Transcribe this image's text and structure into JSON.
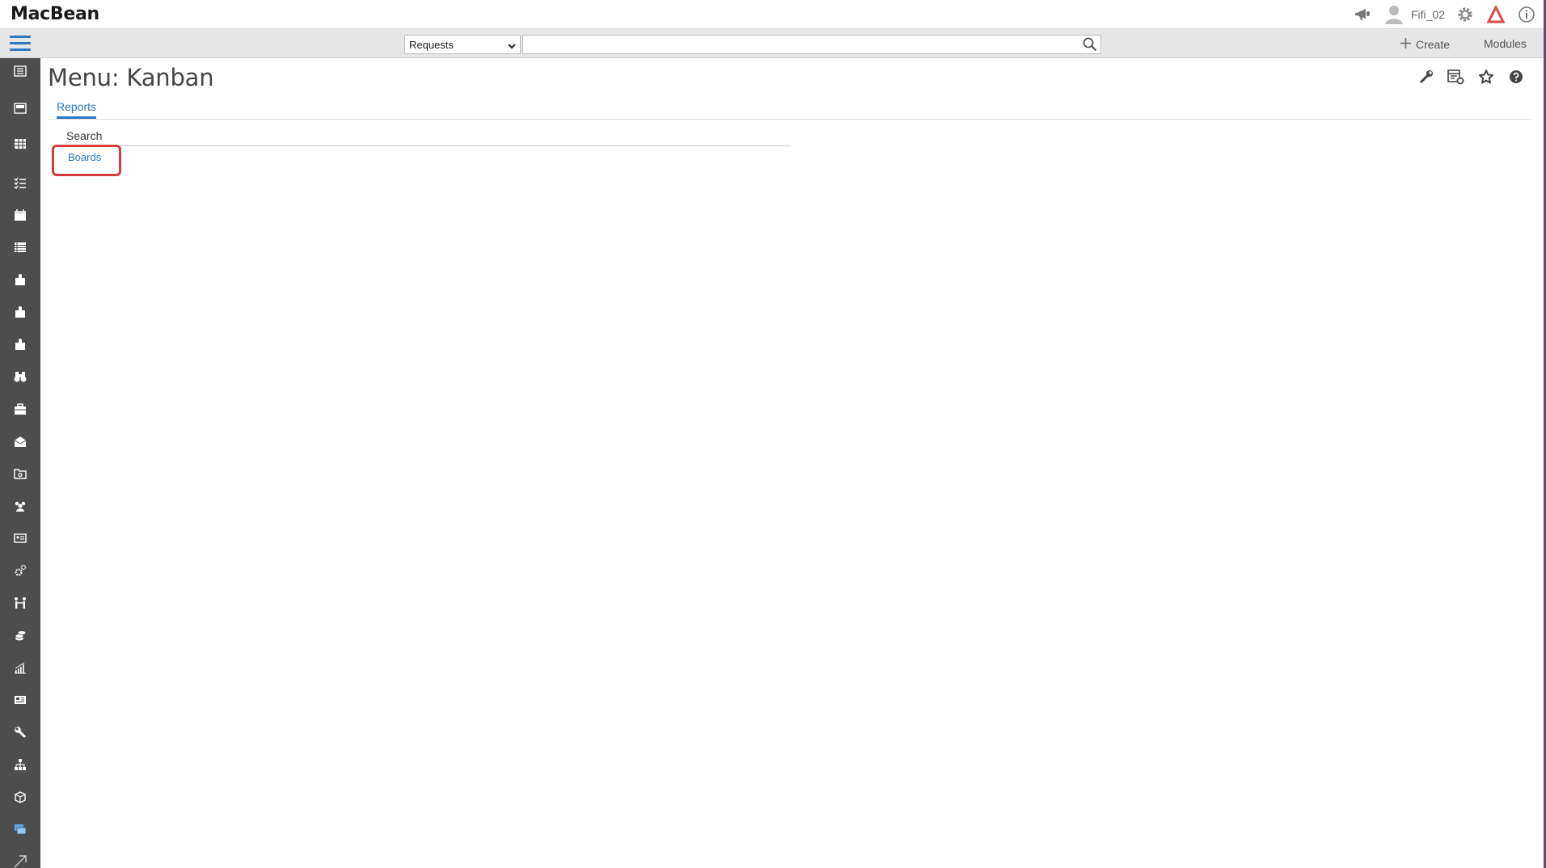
{
  "app": {
    "brand": "MacBean"
  },
  "header": {
    "username": "Fifi_02",
    "icons": [
      "megaphone-icon",
      "user-avatar-icon",
      "gear-icon",
      "brand-logo-icon",
      "info-icon"
    ]
  },
  "toolbar": {
    "search_scope": "Requests",
    "search_placeholder": "",
    "create_label": "Create",
    "modules_label": "Modules"
  },
  "sidebar": {
    "items": [
      "building-icon",
      "tray-icon",
      "table-icon",
      "tasks-icon",
      "calendar-icon",
      "list-icon",
      "puzzle-icon",
      "puzzle-icon",
      "puzzle-icon",
      "binoculars-icon",
      "briefcase-icon",
      "mail-open-icon",
      "folder-icon",
      "people-icon",
      "contact-card-icon",
      "gears-icon",
      "network-people-icon",
      "coins-icon",
      "chart-icon",
      "news-icon",
      "wrench-icon",
      "org-chart-icon",
      "package-icon",
      "windows-icon",
      "expand-icon"
    ]
  },
  "page": {
    "title": "Menu: Kanban",
    "tab": "Reports",
    "section_title": "Search",
    "section_link": "Boards"
  },
  "colors": {
    "accent": "#2a78c0",
    "sidebar": "#4d4d4d",
    "highlight": "#d93a3a",
    "frame": "#5b4a8a"
  }
}
